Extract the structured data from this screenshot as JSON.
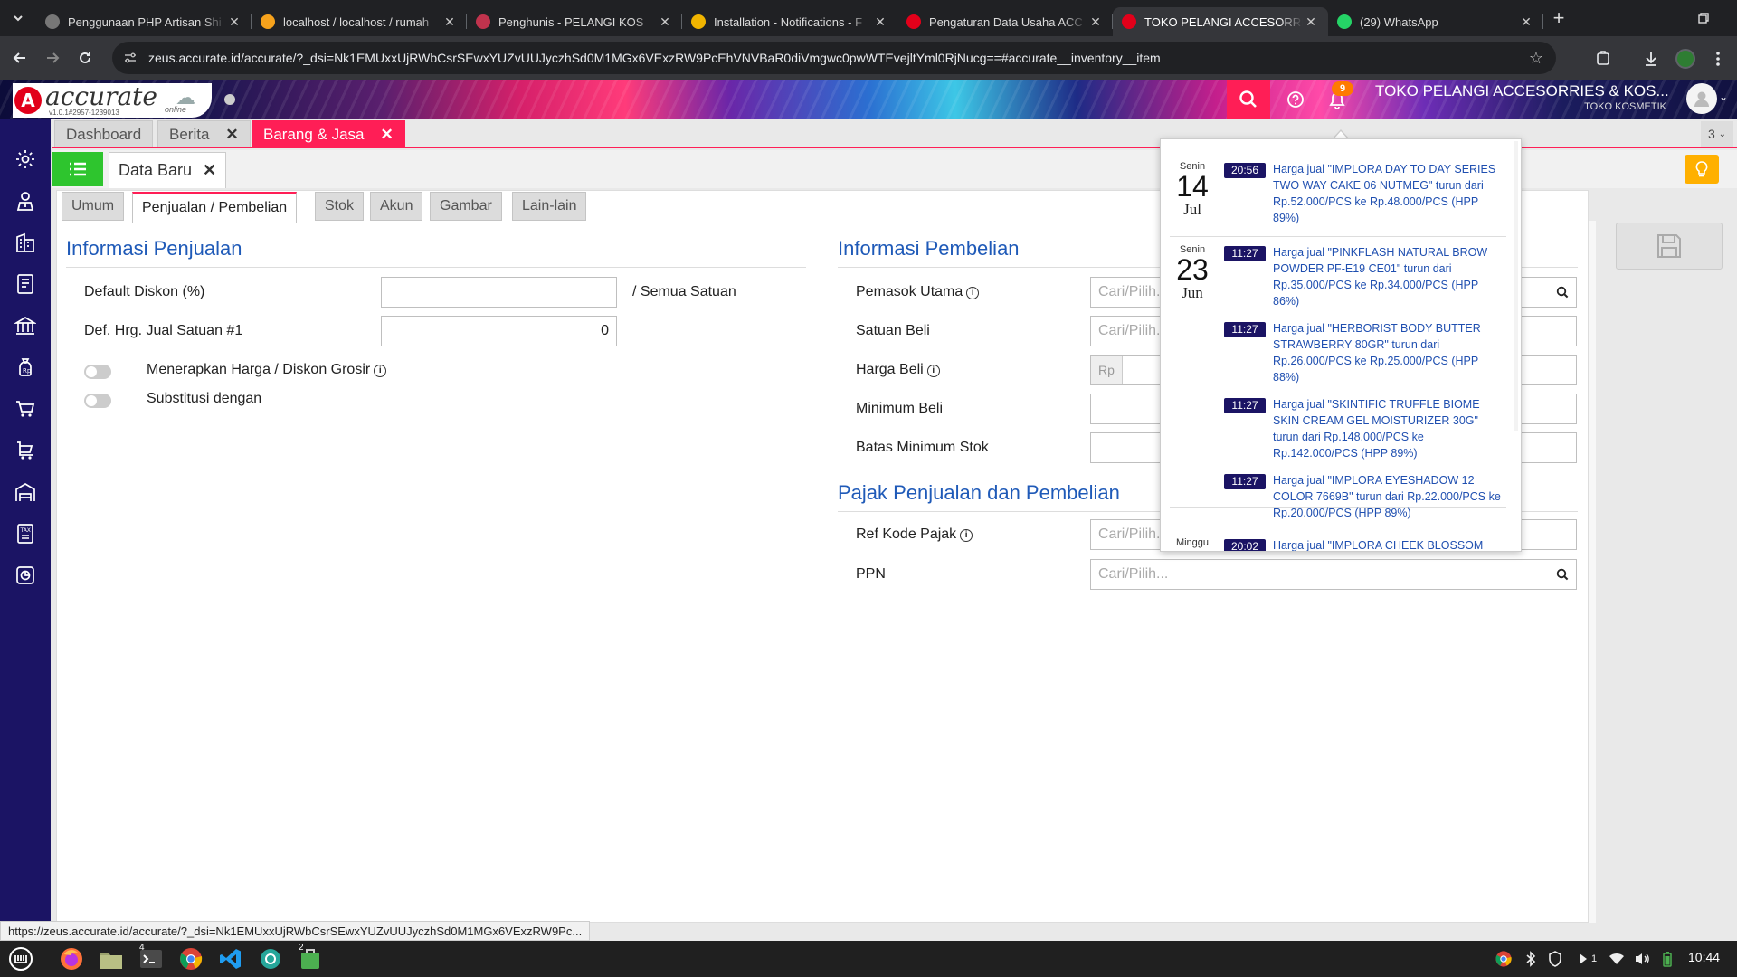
{
  "browser": {
    "tabs": [
      {
        "title": "Penggunaan PHP Artisan Shi",
        "favicon_color": "#777777",
        "active": false
      },
      {
        "title": "localhost / localhost / rumah",
        "favicon_color": "#f6a21c",
        "active": false
      },
      {
        "title": "Penghunis - PELANGI KOS",
        "favicon_color": "#c0334d",
        "active": false
      },
      {
        "title": "Installation - Notifications - F",
        "favicon_color": "#f0b400",
        "active": false
      },
      {
        "title": "Pengaturan Data Usaha ACC",
        "favicon_color": "#e2001a",
        "active": false
      },
      {
        "title": "TOKO PELANGI ACCESORRIE",
        "favicon_color": "#e2001a",
        "active": true
      },
      {
        "title": "(29) WhatsApp",
        "favicon_color": "#25d366",
        "active": false
      }
    ],
    "url": "zeus.accurate.id/accurate/?_dsi=Nk1EMUxxUjRWbCsrSEwxYUZvUUJyczhSd0M1MGx6VExzRW9PcEhVNVBaR0diVmgwc0pwWTEvejltYml0RjNucg==#accurate__inventory__item",
    "status_url": "https://zeus.accurate.id/accurate/?_dsi=Nk1EMUxxUjRWbCsrSEwxYUZvUUJyczhSd0M1MGx6VExzRW9Pc..."
  },
  "app": {
    "logo_text": "accurate",
    "version": "v1.0.1#2957-1239013",
    "online_label": "online",
    "notification_count": "9",
    "company_name": "TOKO PELANGI ACCESORRIES & KOS...",
    "company_sub": "TOKO KOSMETIK",
    "accent_color": "#ff1e56",
    "sidebar_color": "#1b1464"
  },
  "module_tabs": [
    {
      "label": "Dashboard",
      "closable": false
    },
    {
      "label": "Berita",
      "closable": true
    },
    {
      "label": "Barang & Jasa",
      "closable": true,
      "active": true
    }
  ],
  "open_tab_count": "3",
  "doc_tab": {
    "label": "Data Baru"
  },
  "sub_tabs": [
    "Umum",
    "Penjualan / Pembelian",
    "Stok",
    "Akun",
    "Gambar",
    "Lain-lain"
  ],
  "sales": {
    "heading": "Informasi Penjualan",
    "default_discount_label": "Default Diskon (%)",
    "default_discount_value": "",
    "all_units_label": "/ Semua Satuan",
    "price_label": "Def. Hrg. Jual Satuan #1",
    "price_value": "0",
    "wholesale_label": "Menerapkan Harga / Diskon Grosir",
    "substitute_label": "Substitusi dengan"
  },
  "purchase": {
    "heading": "Informasi Pembelian",
    "supplier_label": "Pemasok Utama",
    "unit_label": "Satuan Beli",
    "price_label": "Harga Beli",
    "price_prefix": "Rp",
    "min_buy_label": "Minimum Beli",
    "min_stock_label": "Batas Minimum Stok",
    "placeholder": "Cari/Pilih..."
  },
  "tax": {
    "heading": "Pajak Penjualan dan Pembelian",
    "ref_label": "Ref Kode Pajak",
    "ppn_label": "PPN",
    "placeholder": "Cari/Pilih..."
  },
  "notifications": [
    {
      "day_name": "Senin",
      "day": "14",
      "month": "Jul",
      "items": [
        {
          "time": "20:56",
          "text": "Harga jual \"IMPLORA DAY TO DAY SERIES TWO WAY CAKE 06 NUTMEG\" turun dari Rp.52.000/PCS ke Rp.48.000/PCS (HPP 89%)"
        }
      ]
    },
    {
      "day_name": "Senin",
      "day": "23",
      "month": "Jun",
      "items": [
        {
          "time": "11:27",
          "text": "Harga jual \"PINKFLASH NATURAL BROW POWDER PF-E19 CE01\" turun dari Rp.35.000/PCS ke Rp.34.000/PCS (HPP 86%)"
        },
        {
          "time": "11:27",
          "text": "Harga jual \"HERBORIST BODY BUTTER STRAWBERRY 80GR\" turun dari Rp.26.000/PCS ke Rp.25.000/PCS (HPP 88%)"
        },
        {
          "time": "11:27",
          "text": "Harga jual \"SKINTIFIC TRUFFLE BIOME SKIN CREAM GEL MOISTURIZER 30G\" turun dari Rp.148.000/PCS ke Rp.142.000/PCS (HPP 89%)"
        },
        {
          "time": "11:27",
          "text": "Harga jual \"IMPLORA EYESHADOW 12 COLOR 7669B\" turun dari Rp.22.000/PCS ke Rp.20.000/PCS (HPP 89%)"
        }
      ]
    },
    {
      "day_name": "Minggu",
      "day": "",
      "month": "",
      "items": [
        {
          "time": "20:02",
          "text": "Harga jual \"IMPLORA CHEEK BLOSSOM"
        }
      ]
    }
  ],
  "taskbar": {
    "terminal_badge": "4",
    "files_badge": "2",
    "tray_count": "1",
    "clock": "10:44"
  }
}
